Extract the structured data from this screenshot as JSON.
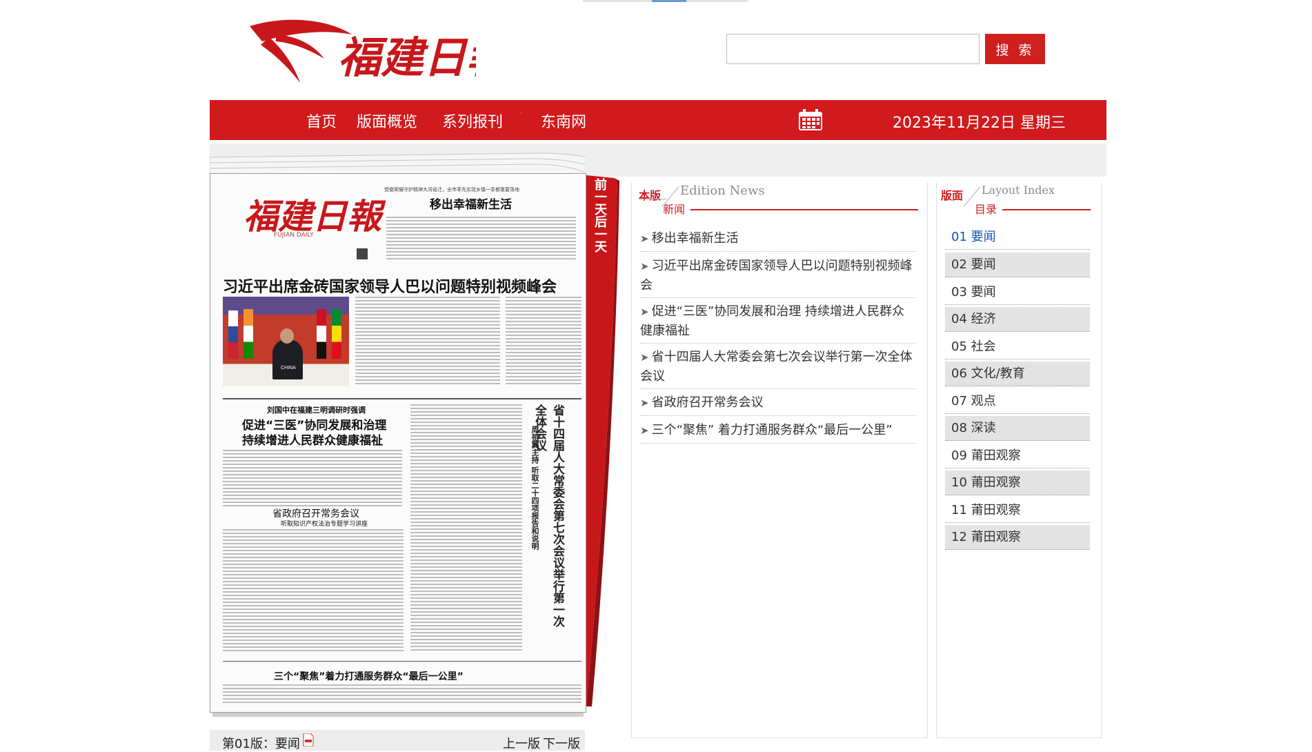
{
  "header": {
    "logo_text": "福建日報",
    "search": {
      "value": "",
      "button_label": "搜 索"
    }
  },
  "nav": {
    "items": [
      "首页",
      "版面概览",
      "系列报刊",
      "东南网"
    ],
    "dropdown_arrow": "˙",
    "calendar_icon": "calendar-icon",
    "date": "2023年11月22日 星期三"
  },
  "paper": {
    "masthead": "福建日報",
    "masthead_en": "FUJIAN DAILY",
    "headline_main": "习近平出席金砖国家领导人巴以问题特别视频峰会",
    "headline_top": "移出幸福新生活",
    "headline_top_kicker": "党徽荣耀守护精神大湾省迁，全市率先实现乡镇一条都重要落地",
    "headline_2_kicker": "刘国中在福建三明调研时强调",
    "headline_2_line1": "促进“三医”协同发展和治理",
    "headline_2_line2": "持续增进人民群众健康福祉",
    "headline_side": "省十四届人大常委会第七次会议举行第一次全体会议",
    "headline_side_sub": "周祖翼主持 听取二十四项报告和说明",
    "headline_3": "省政府召开常务会议",
    "headline_3_sub": "听取知识产权法治专题学习讲座",
    "headline_4": "三个“聚焦”着力打通服务群众“最后一公里”",
    "photo_label": "CHINA"
  },
  "ribbon": {
    "text": "前一天后一天"
  },
  "page_footer": {
    "label": "第01版：要闻",
    "pdf_icon": "pdf-icon",
    "prev": "上一版",
    "next": "下一版"
  },
  "edition_news": {
    "title_cn_a": "本版",
    "title_cn_b": "新闻",
    "title_en": "Edition News",
    "items": [
      "移出幸福新生活",
      "习近平出席金砖国家领导人巴以问题特别视频峰会",
      "促进“三医”协同发展和治理 持续增进人民群众健康福祉",
      "省十四届人大常委会第七次会议举行第一次全体会议",
      "省政府召开常务会议",
      "三个“聚焦” 着力打通服务群众“最后一公里”"
    ]
  },
  "layout_index": {
    "title_cn_a": "版面",
    "title_cn_b": "目录",
    "title_en": "Layout Index",
    "items": [
      "01 要闻",
      "02 要闻",
      "03 要闻",
      "04 经济",
      "05 社会",
      "06 文化/教育",
      "07 观点",
      "08 深读",
      "09 莆田观察",
      "10 莆田观察",
      "11 莆田观察",
      "12 莆田观察"
    ]
  },
  "colors": {
    "brand_red": "#d01a1d",
    "link_blue": "#1a55b0"
  }
}
